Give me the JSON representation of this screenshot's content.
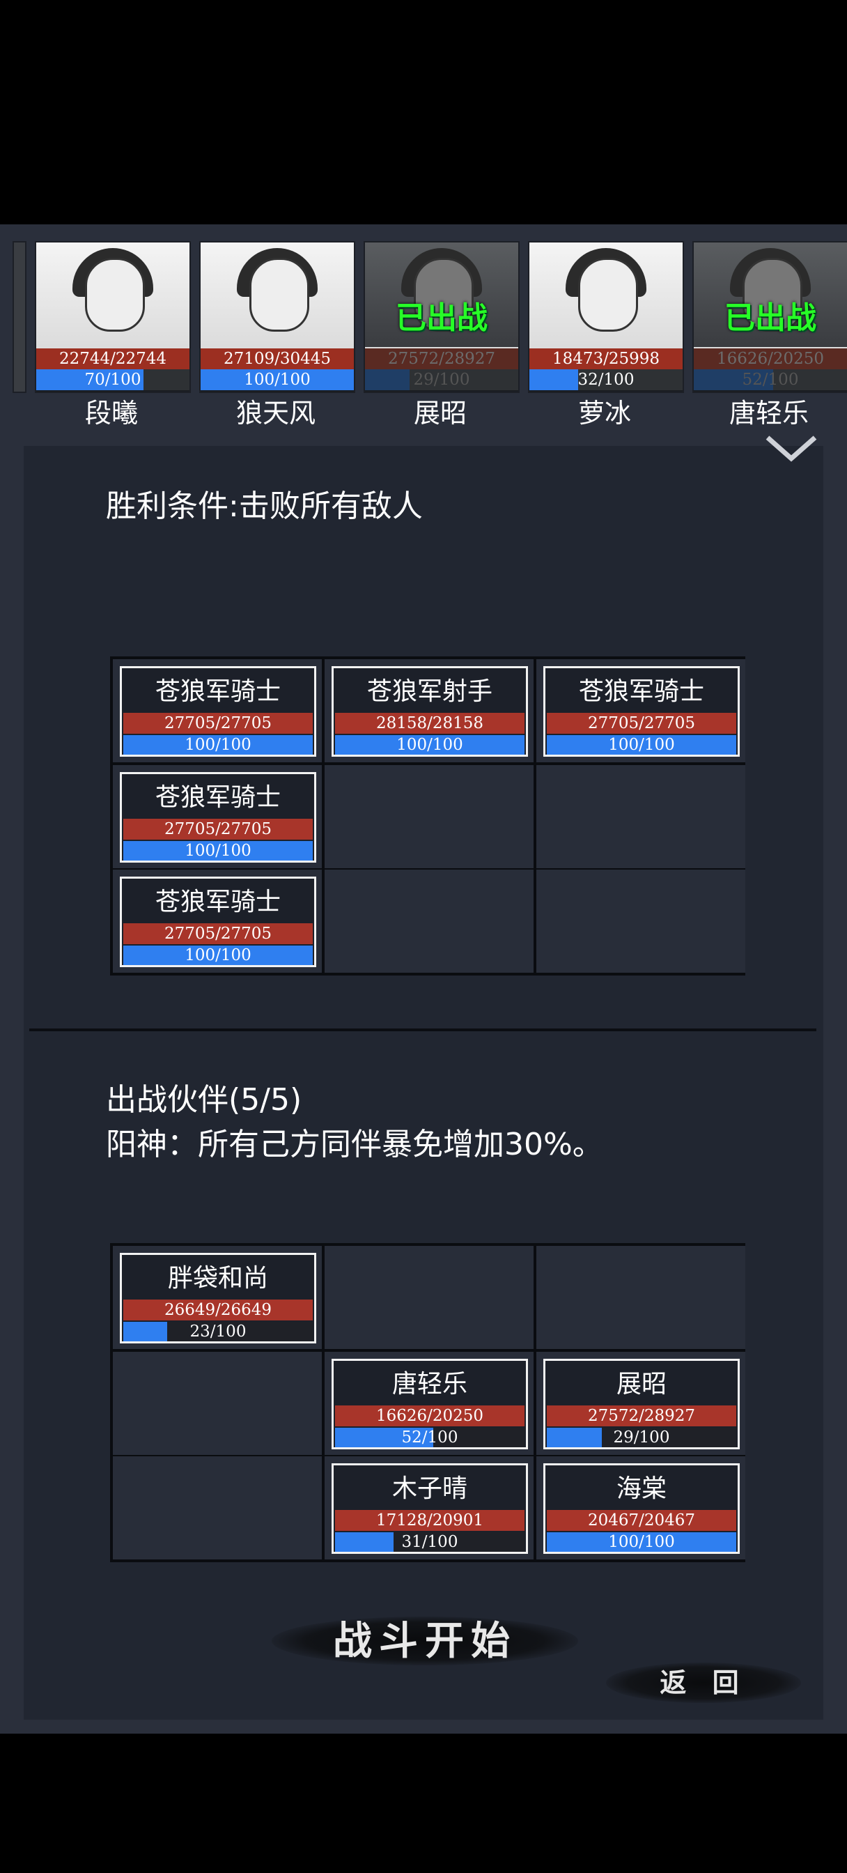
{
  "roster": [
    {
      "name": "段曦",
      "hp": "22744/22744",
      "mp": "70/100",
      "mp_pct": 0.7,
      "deployed": false
    },
    {
      "name": "狼天风",
      "hp": "27109/30445",
      "mp": "100/100",
      "mp_pct": 1.0,
      "deployed": false
    },
    {
      "name": "展昭",
      "hp": "27572/28927",
      "mp": "29/100",
      "mp_pct": 0.29,
      "deployed": true
    },
    {
      "name": "萝冰",
      "hp": "18473/25998",
      "mp": "32/100",
      "mp_pct": 0.32,
      "deployed": false
    },
    {
      "name": "唐轻乐",
      "hp": "16626/20250",
      "mp": "52/100",
      "mp_pct": 0.52,
      "deployed": true
    }
  ],
  "deployed_label": "已出战",
  "victory_condition": "胜利条件:击败所有敌人",
  "enemies": [
    {
      "name": "苍狼军骑士",
      "hp": "27705/27705",
      "mp": "100/100",
      "mp_pct": 1.0
    },
    {
      "name": "苍狼军射手",
      "hp": "28158/28158",
      "mp": "100/100",
      "mp_pct": 1.0
    },
    {
      "name": "苍狼军骑士",
      "hp": "27705/27705",
      "mp": "100/100",
      "mp_pct": 1.0
    },
    {
      "name": "苍狼军骑士",
      "hp": "27705/27705",
      "mp": "100/100",
      "mp_pct": 1.0
    },
    {
      "name": "苍狼军骑士",
      "hp": "27705/27705",
      "mp": "100/100",
      "mp_pct": 1.0
    }
  ],
  "party_title": "出战伙伴(5/5)",
  "party_buff": "阳神：所有己方同伴暴免增加30%。",
  "party": [
    {
      "name": "胖袋和尚",
      "hp": "26649/26649",
      "mp": "23/100",
      "mp_pct": 0.23
    },
    {
      "name": "唐轻乐",
      "hp": "16626/20250",
      "mp": "52/100",
      "mp_pct": 0.52
    },
    {
      "name": "展昭",
      "hp": "27572/28927",
      "mp": "29/100",
      "mp_pct": 0.29
    },
    {
      "name": "木子晴",
      "hp": "17128/20901",
      "mp": "31/100",
      "mp_pct": 0.31
    },
    {
      "name": "海棠",
      "hp": "20467/20467",
      "mp": "100/100",
      "mp_pct": 1.0
    }
  ],
  "start_label": "战斗开始",
  "back_label": "返 回",
  "colors": {
    "hp": "#a8352a",
    "mp": "#2f7ff0",
    "deployed": "#27ff27",
    "panel": "#212631"
  }
}
